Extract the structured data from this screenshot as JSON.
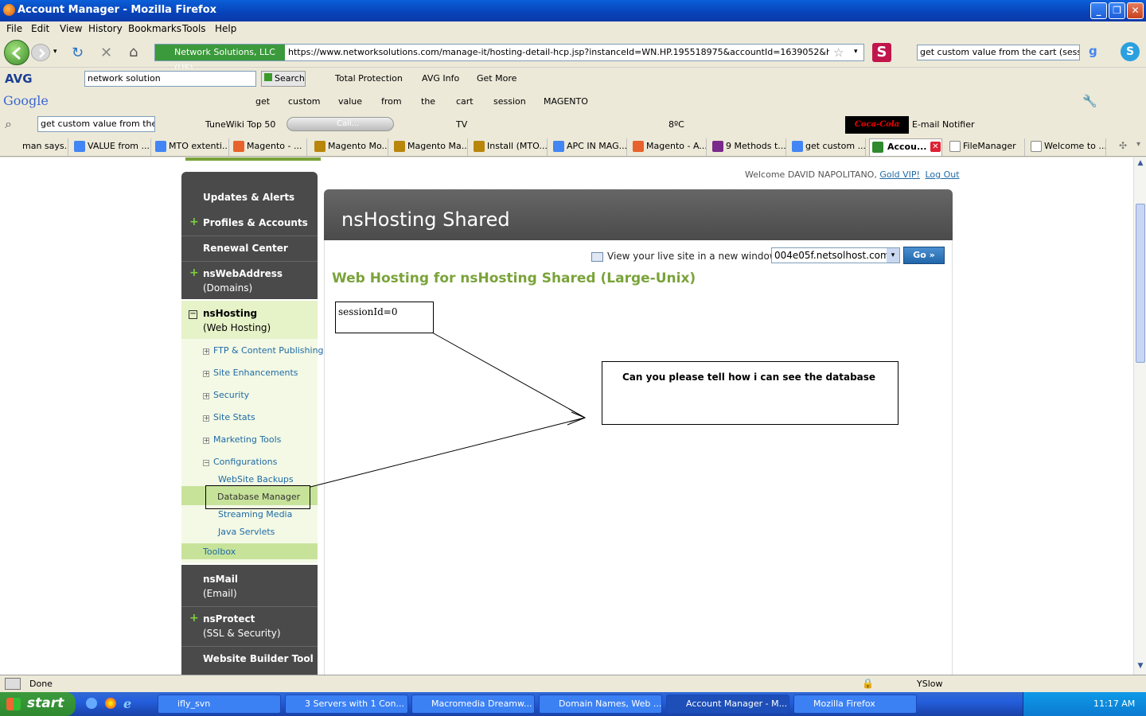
{
  "window": {
    "title": "Account Manager - Mozilla Firefox"
  },
  "menu": [
    "File",
    "Edit",
    "View",
    "History",
    "Bookmarks",
    "Tools",
    "Help"
  ],
  "nav": {
    "site_identity": "Network Solutions, LLC (US)",
    "url": "https://www.networksolutions.com/manage-it/hosting-detail-hcp.jsp?instanceId=WN.HP.195518975&accountId=1639052&hcpPageId=hcp_c",
    "search_value": "get custom value from the cart (sessi"
  },
  "avg_bar": {
    "brand": "AVG",
    "search_value": "network solution",
    "search_label": "Search",
    "total_protection": "Total Protection",
    "avg_info": "AVG Info",
    "get_more": "Get More"
  },
  "google_bar": {
    "brand": "Google",
    "terms": [
      "get",
      "custom",
      "value",
      "from",
      "the",
      "cart",
      "session",
      "MAGENTO"
    ]
  },
  "tune_bar": {
    "search_value": "get custom value from the",
    "tunewiki": "TuneWiki Top 50",
    "cali": "Cali...",
    "tv": "TV",
    "temp": "8ºC",
    "coke": "Coca-Cola zero",
    "email": "E-mail Notifier"
  },
  "tabs": [
    {
      "label": "man says...",
      "color": "#ffffff"
    },
    {
      "label": "VALUE from ...",
      "color": "#4285f4"
    },
    {
      "label": "MTO extenti...",
      "color": "#4285f4"
    },
    {
      "label": "Magento - ...",
      "color": "#e8632b"
    },
    {
      "label": "Magento Mo...",
      "color": "#b8860b"
    },
    {
      "label": "Magento Ma...",
      "color": "#b8860b"
    },
    {
      "label": "Install (MTO...",
      "color": "#b8860b"
    },
    {
      "label": "APC IN MAG...",
      "color": "#4285f4"
    },
    {
      "label": "Magento - A...",
      "color": "#e8632b"
    },
    {
      "label": "9 Methods t...",
      "color": "#7a2a8a"
    },
    {
      "label": "get custom ...",
      "color": "#4285f4"
    },
    {
      "label": "Accou...",
      "color": "#2f8a2f"
    },
    {
      "label": "FileManager",
      "color": "#ffffff"
    },
    {
      "label": "Welcome to ...",
      "color": "#ffffff"
    }
  ],
  "page": {
    "welcome": "Welcome DAVID NAPOLITANO,",
    "gold_vip": "Gold VIP!",
    "logout": "Log Out",
    "panel_title": "nsHosting Shared",
    "view_live": "View your live site in a new window:",
    "site_select": "004e05f.netsolhost.com",
    "go_label": "Go »",
    "heading": "Web Hosting for nsHosting Shared (Large-Unix)",
    "session_note": "sessionId=0",
    "question_note": "Can you please tell how i can see the database"
  },
  "leftnav": {
    "updates": "Updates & Alerts",
    "profiles": "Profiles & Accounts",
    "renewal": "Renewal Center",
    "webaddress": "nsWebAddress",
    "webaddress_sub": "(Domains)",
    "hosting": "nsHosting",
    "hosting_sub": "(Web Hosting)",
    "hosting_items": [
      "FTP & Content Publishing",
      "Site Enhancements",
      "Security",
      "Site Stats",
      "Marketing Tools",
      "Configurations"
    ],
    "config_items": [
      "WebSite Backups",
      "Database Manager",
      "Streaming Media",
      "Java Servlets"
    ],
    "toolbox": "Toolbox",
    "mail": "nsMail",
    "mail_sub": "(Email)",
    "protect": "nsProtect",
    "protect_sub": "(SSL & Security)",
    "builder": "Website Builder Tool"
  },
  "status": {
    "text": "Done",
    "yslow": "YSlow"
  },
  "taskbar": {
    "start": "start",
    "tasks": [
      "ifly_svn",
      "3 Servers with 1 Con...",
      "Macromedia Dreamw...",
      "Domain Names, Web ...",
      "Account Manager - M...",
      "Mozilla Firefox"
    ],
    "clock": "11:17 AM"
  }
}
